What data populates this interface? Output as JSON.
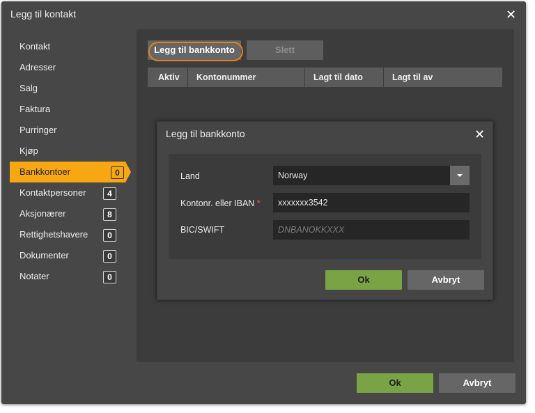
{
  "window": {
    "title": "Legg til kontakt"
  },
  "sidebar": {
    "items": [
      {
        "label": "Kontakt",
        "badge": ""
      },
      {
        "label": "Adresser",
        "badge": ""
      },
      {
        "label": "Salg",
        "badge": ""
      },
      {
        "label": "Faktura",
        "badge": ""
      },
      {
        "label": "Purringer",
        "badge": ""
      },
      {
        "label": "Kjøp",
        "badge": ""
      },
      {
        "label": "Bankkontoer",
        "badge": "0",
        "active": true
      },
      {
        "label": "Kontaktpersoner",
        "badge": "4"
      },
      {
        "label": "Aksjonærer",
        "badge": "8"
      },
      {
        "label": "Rettighetshavere",
        "badge": "0"
      },
      {
        "label": "Dokumenter",
        "badge": "0"
      },
      {
        "label": "Notater",
        "badge": "0"
      }
    ]
  },
  "main": {
    "add_button": "Legg til bankkonto",
    "delete_button": "Slett",
    "table_headers": [
      "Aktiv",
      "Kontonummer",
      "Lagt til dato",
      "Lagt til av"
    ]
  },
  "modal": {
    "title": "Legg til bankkonto",
    "country_label": "Land",
    "country_value": "Norway",
    "account_label": "Kontonr. eller IBAN",
    "required_mark": "*",
    "account_value": "xxxxxxx3542",
    "bic_label": "BIC/SWIFT",
    "bic_placeholder": "DNBANOKKXXX",
    "ok": "Ok",
    "cancel": "Avbryt"
  },
  "footer": {
    "ok": "Ok",
    "cancel": "Avbryt"
  },
  "colors": {
    "accent": "#f7a712",
    "ok_green": "#7aa345",
    "highlight": "#e67e22"
  },
  "icons": {
    "close": "close-icon",
    "dropdown": "chevron-down-icon"
  }
}
